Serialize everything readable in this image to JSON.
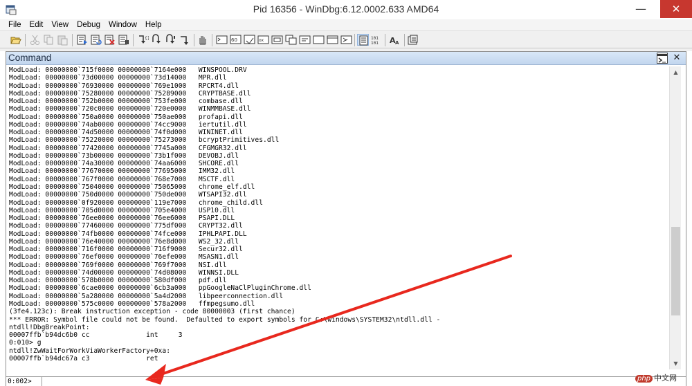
{
  "window": {
    "title": "Pid 16356 - WinDbg:6.12.0002.633 AMD64",
    "minimize_glyph": "—",
    "restore_glyph": "□",
    "close_glyph": "✕"
  },
  "menu": [
    "File",
    "Edit",
    "View",
    "Debug",
    "Window",
    "Help"
  ],
  "toolbar_icons": [
    "open-icon",
    "cut-icon",
    "copy-icon",
    "paste-icon",
    "go-icon",
    "restart-icon",
    "stop-icon",
    "break-icon",
    "step-into-icon",
    "step-over-icon",
    "step-out-icon",
    "run-to-cursor-icon",
    "hand-icon",
    "command-icon",
    "watch-icon",
    "locals-icon",
    "registers-icon",
    "memory-icon",
    "call-stack-icon",
    "disassembly-icon",
    "scratch-pad-icon",
    "processes-icon",
    "source-mode-icon",
    "hex-mode-icon",
    "font-icon",
    "options-icon"
  ],
  "command_window": {
    "title": "Command",
    "close_glyph": "✕",
    "lines": [
      "ModLoad: 00000000`715f0000 00000000`7164e000   WINSPOOL.DRV",
      "ModLoad: 00000000`73d00000 00000000`73d14000   MPR.dll",
      "ModLoad: 00000000`76930000 00000000`769e1000   RPCRT4.dll",
      "ModLoad: 00000000`75280000 00000000`75289000   CRYPTBASE.dll",
      "ModLoad: 00000000`752b0000 00000000`753fe000   combase.dll",
      "ModLoad: 00000000`720c0000 00000000`720e0000   WINMMBASE.dll",
      "ModLoad: 00000000`750a0000 00000000`750ae000   profapi.dll",
      "ModLoad: 00000000`74ab0000 00000000`74cc9000   iertutil.dll",
      "ModLoad: 00000000`74d50000 00000000`74f0d000   WININET.dll",
      "ModLoad: 00000000`75220000 00000000`75273000   bcryptPrimitives.dll",
      "ModLoad: 00000000`77420000 00000000`7745a000   CFGMGR32.dll",
      "ModLoad: 00000000`73b00000 00000000`73b1f000   DEVOBJ.dll",
      "ModLoad: 00000000`74a30000 00000000`74aa6000   SHCORE.dll",
      "ModLoad: 00000000`77670000 00000000`77695000   IMM32.dll",
      "ModLoad: 00000000`767f0000 00000000`768e7000   MSCTF.dll",
      "ModLoad: 00000000`75040000 00000000`75065000   chrome_elf.dll",
      "ModLoad: 00000000`750d0000 00000000`750de000   WTSAPI32.dll",
      "ModLoad: 00000000`0f920000 00000000`119e7000   chrome_child.dll",
      "ModLoad: 00000000`705d0000 00000000`705e4000   USP10.dll",
      "ModLoad: 00000000`76ee0000 00000000`76ee6000   PSAPI.DLL",
      "ModLoad: 00000000`77460000 00000000`775df000   CRYPT32.dll",
      "ModLoad: 00000000`74fb0000 00000000`74fce000   IPHLPAPI.DLL",
      "ModLoad: 00000000`76e40000 00000000`76e8d000   WS2_32.dll",
      "ModLoad: 00000000`716f0000 00000000`716f9000   Secur32.dll",
      "ModLoad: 00000000`76ef0000 00000000`76efe000   MSASN1.dll",
      "ModLoad: 00000000`769f0000 00000000`769f7000   NSI.dll",
      "ModLoad: 00000000`74d00000 00000000`74d08000   WINNSI.DLL",
      "ModLoad: 00000000`578b0000 00000000`580df000   pdf.dll",
      "ModLoad: 00000000`6cae0000 00000000`6cb3a000   ppGoogleNaClPluginChrome.dll",
      "ModLoad: 00000000`5a280000 00000000`5a4d2000   libpeerconnection.dll",
      "ModLoad: 00000000`575c0000 00000000`578a2000   ffmpegsumo.dll",
      "(3fe4.123c): Break instruction exception - code 80000003 (first chance)",
      "*** ERROR: Symbol file could not be found.  Defaulted to export symbols for C:\\windows\\SYSTEM32\\ntdll.dll -",
      "ntdll!DbgBreakPoint:",
      "00007ffb`b94dc6b0 cc              int     3",
      "0:010> g",
      "ntdll!ZwWaitForWorkViaWorkerFactory+0xa:",
      "00007ffb`b94dc67a c3              ret"
    ],
    "prompt": "0:002>",
    "input_value": "",
    "scroll_fraction": 0.78
  },
  "watermark": {
    "logo": "php",
    "text": "中文网"
  },
  "colors": {
    "annotation_arrow": "#e8281e",
    "close_button": "#c7372f"
  }
}
